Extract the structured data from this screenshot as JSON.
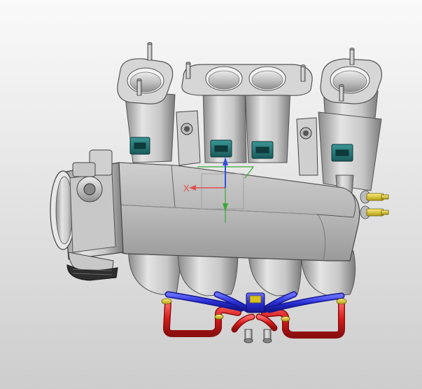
{
  "viewport": {
    "background_top": "#fafafa",
    "background_bottom": "#cdcdcd"
  },
  "model": {
    "body_color": "#d4d4d4",
    "connector_color": "#1f6f70",
    "coolant_hot_color": "#d81c1c",
    "coolant_cold_color": "#2a2fd6",
    "fitting_color": "#d9c21f"
  },
  "triad": {
    "x_label": "X",
    "x_color": "#e05050",
    "y_color": "#3aa83a",
    "z_color": "#3050e0"
  }
}
